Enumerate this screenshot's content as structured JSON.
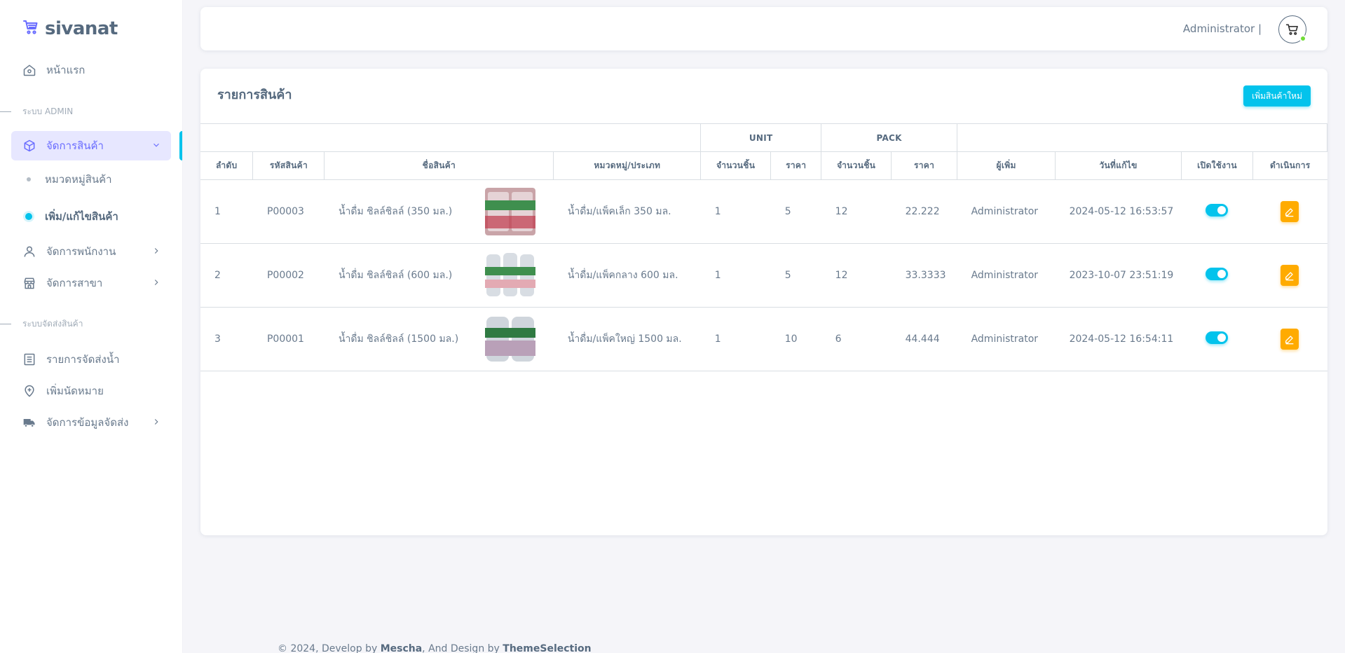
{
  "brand": {
    "name": "sivanat"
  },
  "sidebar": {
    "home": "หน้าแรก",
    "header_admin": "ระบบ ADMIN",
    "products": "จัดการสินค้า",
    "sub_category": "หมวดหมู่สินค้า",
    "sub_add_edit": "เพิ่ม/แก้ไขสินค้า",
    "employees": "จัดการพนักงาน",
    "branches": "จัดการสาขา",
    "header_delivery": "ระบบจัดส่งสินค้า",
    "delivery_list": "รายการจัดส่งน้ำ",
    "appointment": "เพิ่มนัดหมาย",
    "delivery_data": "จัดการข้อมูลจัดส่ง"
  },
  "navbar": {
    "user": "Administrator |"
  },
  "card": {
    "title": "รายการสินค้า",
    "add_button": "เพิ่มสินค้าใหม่"
  },
  "table": {
    "group_unit": "UNIT",
    "group_pack": "PACK",
    "headers": {
      "no": "ลำดับ",
      "code": "รหัสสินค้า",
      "name": "ชื่อสินค้า",
      "category": "หมวดหมู่/ประเภท",
      "unit_qty": "จำนวนชิ้น",
      "unit_price": "ราคา",
      "pack_qty": "จำนวนชิ้น",
      "pack_price": "ราคา",
      "added_by": "ผู้เพิ่ม",
      "modified": "วันที่แก้ไข",
      "enabled": "เปิดใช้งาน",
      "action": "ดำเนินการ"
    },
    "rows": [
      {
        "no": "1",
        "code": "P00003",
        "name": "น้ำดื่ม ชิลล์ชิลล์ (350 มล.)",
        "category": "น้ำดื่ม/แพ็คเล็ก 350 มล.",
        "unit_qty": "1",
        "unit_price": "5",
        "pack_qty": "12",
        "pack_price": "22.222",
        "added_by": "Administrator",
        "modified": "2024-05-12 16:53:57",
        "enabled": true
      },
      {
        "no": "2",
        "code": "P00002",
        "name": "น้ำดื่ม ชิลล์ชิลล์ (600 มล.)",
        "category": "น้ำดื่ม/แพ็คกลาง 600 มล.",
        "unit_qty": "1",
        "unit_price": "5",
        "pack_qty": "12",
        "pack_price": "33.3333",
        "added_by": "Administrator",
        "modified": "2023-10-07 23:51:19",
        "enabled": true
      },
      {
        "no": "3",
        "code": "P00001",
        "name": "น้ำดื่ม ชิลล์ชิลล์ (1500 มล.)",
        "category": "น้ำดื่ม/แพ็คใหญ่ 1500 มล.",
        "unit_qty": "1",
        "unit_price": "10",
        "pack_qty": "6",
        "pack_price": "44.444",
        "added_by": "Administrator",
        "modified": "2024-05-12 16:54:11",
        "enabled": true
      }
    ]
  },
  "footer": {
    "prefix": "© 2024, Develop by ",
    "dev": "Mescha",
    "mid": ", And Design by ",
    "designer": "ThemeSelection"
  },
  "colors": {
    "accent": "#03c3ec",
    "warning": "#ffab00",
    "active_bg": "#e7e7ff",
    "active_text": "#696cff"
  },
  "icons": [
    "cart-icon",
    "home-icon",
    "box-icon",
    "user-icon",
    "store-icon",
    "list-icon",
    "map-pin-icon",
    "truck-icon",
    "edit-icon",
    "chevron-icon"
  ]
}
